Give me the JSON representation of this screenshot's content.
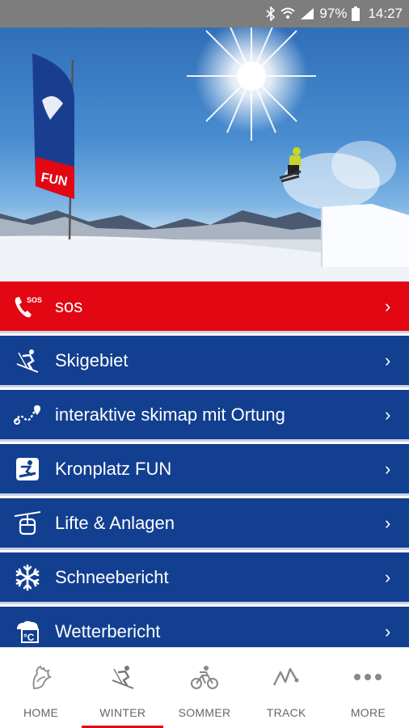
{
  "status_bar": {
    "battery": "97%",
    "time": "14:27",
    "icons": [
      "bluetooth-icon",
      "wifi-icon",
      "signal-icon",
      "battery-icon"
    ]
  },
  "hero": {
    "flag_text": "FUN"
  },
  "menu": {
    "items": [
      {
        "label": "sos",
        "icon": "sos-phone-icon",
        "color": "#e30613"
      },
      {
        "label": "Skigebiet",
        "icon": "skier-icon",
        "color": "#123f90"
      },
      {
        "label": "interaktive skimap mit Ortung",
        "icon": "map-route-icon",
        "color": "#123f90"
      },
      {
        "label": "Kronplatz FUN",
        "icon": "snowboard-icon",
        "color": "#123f90"
      },
      {
        "label": "Lifte & Anlagen",
        "icon": "gondola-icon",
        "color": "#123f90"
      },
      {
        "label": "Schneebericht",
        "icon": "snowflake-icon",
        "color": "#123f90"
      },
      {
        "label": "Wetterbericht",
        "icon": "weather-icon",
        "color": "#123f90"
      }
    ],
    "chevron": "›"
  },
  "bottom_nav": {
    "items": [
      {
        "label": "HOME",
        "icon": "home-rooster-icon",
        "active": false
      },
      {
        "label": "WINTER",
        "icon": "winter-skier-icon",
        "active": true
      },
      {
        "label": "SOMMER",
        "icon": "bike-icon",
        "active": false
      },
      {
        "label": "TRACK",
        "icon": "track-icon",
        "active": false
      },
      {
        "label": "MORE",
        "icon": "more-dots-icon",
        "active": false
      }
    ],
    "active_color": "#e30613"
  }
}
